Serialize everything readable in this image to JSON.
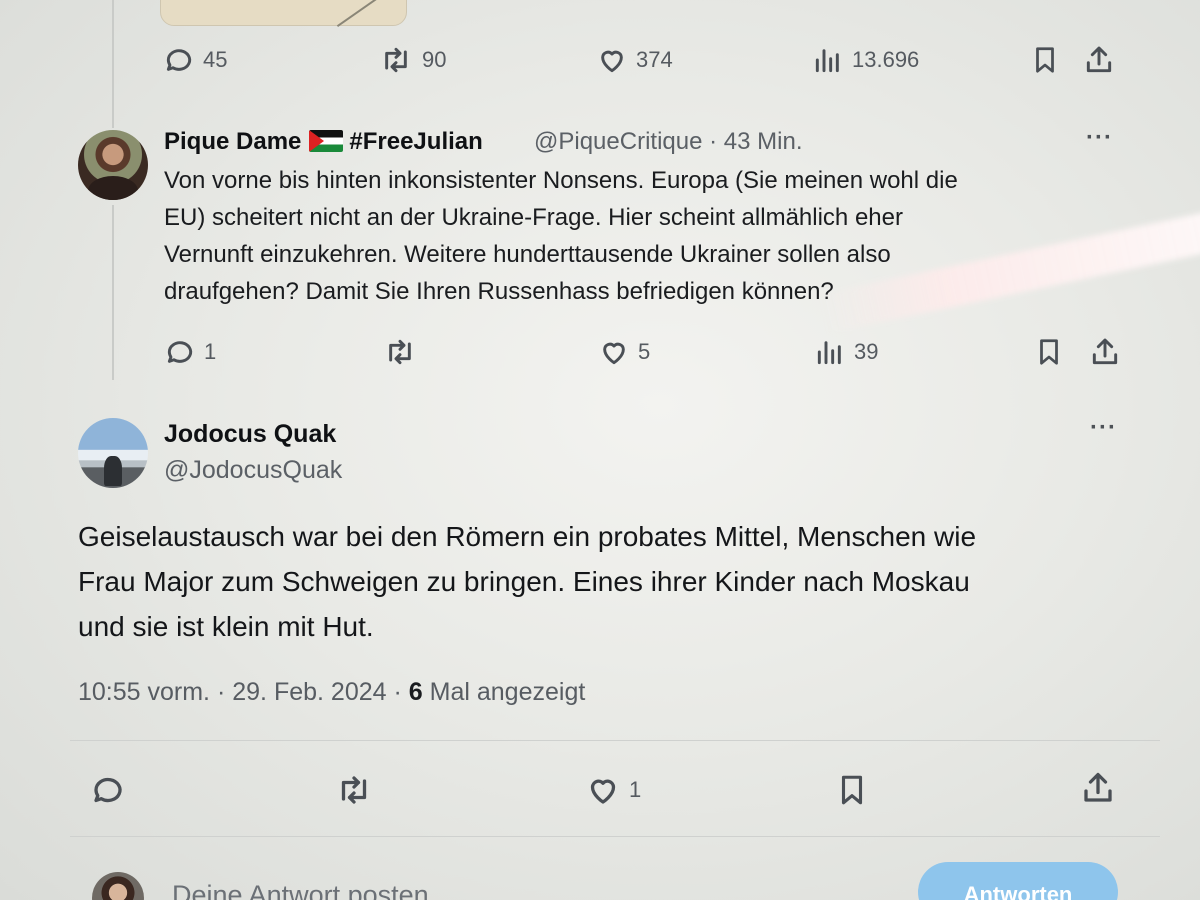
{
  "colors": {
    "background": "#e9eae6",
    "text": "#1a1c1f",
    "secondary_text": "#575c62",
    "reply_button": "#8ec5ec"
  },
  "previous_tweet": {
    "stats": {
      "replies": "45",
      "reposts": "90",
      "likes": "374",
      "views": "13.696"
    }
  },
  "reply_tweet": {
    "display_name": "Pique Dame",
    "flag_icon": "palestine-flag-icon",
    "hashtag": "#FreeJulian",
    "handle": "@PiqueCritique",
    "separator": "·",
    "time": "43 Min.",
    "text_lines": [
      "Von vorne bis hinten inkonsistenter Nonsens. Europa (Sie meinen wohl die",
      "EU) scheitert nicht an der Ukraine-Frage. Hier scheint allmählich eher",
      "Vernunft einzukehren. Weitere hunderttausende Ukrainer sollen also",
      "draufgehen? Damit Sie Ihren Russenhass befriedigen können?"
    ],
    "stats": {
      "replies": "1",
      "likes": "5",
      "views": "39"
    }
  },
  "main_tweet": {
    "display_name": "Jodocus Quak",
    "handle": "@JodocusQuak",
    "text_lines": [
      "Geiselaustausch war bei den Römern ein probates Mittel, Menschen wie",
      "Frau Major zum Schweigen zu bringen. Eines ihrer Kinder nach Moskau",
      "und sie ist klein mit Hut."
    ],
    "time": "10:55 vorm.",
    "date": "29. Feb. 2024",
    "views_count": "6",
    "views_label": "Mal angezeigt",
    "separator": "·",
    "stats": {
      "likes": "1"
    }
  },
  "composer": {
    "placeholder": "Deine Antwort posten",
    "button_label": "Antworten"
  },
  "more_label": "···"
}
